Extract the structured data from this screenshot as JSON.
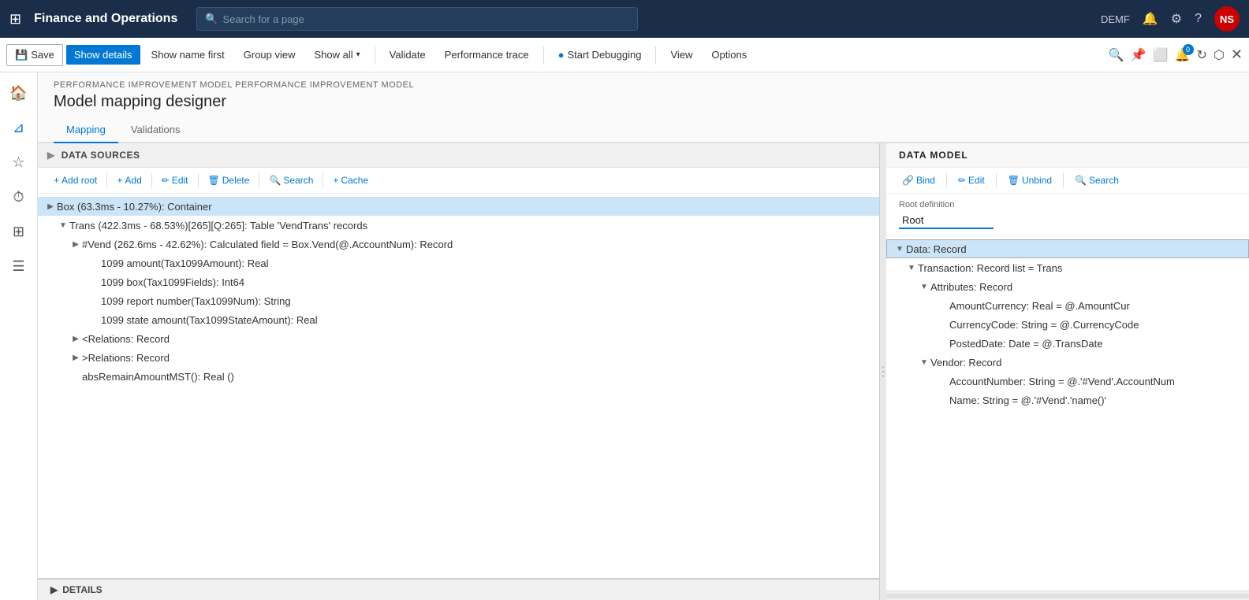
{
  "app": {
    "title": "Finance and Operations",
    "search_placeholder": "Search for a page",
    "user": "DEMF",
    "avatar_initials": "NS"
  },
  "toolbar": {
    "save_label": "Save",
    "show_details_label": "Show details",
    "show_name_first_label": "Show name first",
    "group_view_label": "Group view",
    "show_all_label": "Show all",
    "validate_label": "Validate",
    "performance_trace_label": "Performance trace",
    "start_debugging_label": "Start Debugging",
    "view_label": "View",
    "options_label": "Options"
  },
  "breadcrumb": "PERFORMANCE IMPROVEMENT MODEL PERFORMANCE IMPROVEMENT MODEL",
  "page_title": "Model mapping designer",
  "tabs": [
    {
      "label": "Mapping",
      "active": true
    },
    {
      "label": "Validations",
      "active": false
    }
  ],
  "data_sources": {
    "section_label": "DATA SOURCES",
    "toolbar_buttons": [
      {
        "label": "Add root",
        "icon": "+"
      },
      {
        "label": "Add",
        "icon": "+"
      },
      {
        "label": "Edit",
        "icon": "✏"
      },
      {
        "label": "Delete",
        "icon": "🗑"
      },
      {
        "label": "Search",
        "icon": "🔍"
      },
      {
        "label": "Cache",
        "icon": "+"
      }
    ],
    "tree": [
      {
        "id": 1,
        "indent": 0,
        "has_children": true,
        "expanded": true,
        "selected": true,
        "text": "Box (63.3ms - 10.27%): Container"
      },
      {
        "id": 2,
        "indent": 1,
        "has_children": true,
        "expanded": true,
        "selected": false,
        "text": "Trans (422.3ms - 68.53%)[265][Q:265]: Table 'VendTrans' records"
      },
      {
        "id": 3,
        "indent": 2,
        "has_children": true,
        "expanded": false,
        "selected": false,
        "text": "#Vend (262.6ms - 42.62%): Calculated field = Box.Vend(@.AccountNum): Record"
      },
      {
        "id": 4,
        "indent": 3,
        "has_children": false,
        "expanded": false,
        "selected": false,
        "text": "1099 amount(Tax1099Amount): Real"
      },
      {
        "id": 5,
        "indent": 3,
        "has_children": false,
        "expanded": false,
        "selected": false,
        "text": "1099 box(Tax1099Fields): Int64"
      },
      {
        "id": 6,
        "indent": 3,
        "has_children": false,
        "expanded": false,
        "selected": false,
        "text": "1099 report number(Tax1099Num): String"
      },
      {
        "id": 7,
        "indent": 3,
        "has_children": false,
        "expanded": false,
        "selected": false,
        "text": "1099 state amount(Tax1099StateAmount): Real"
      },
      {
        "id": 8,
        "indent": 2,
        "has_children": true,
        "expanded": false,
        "selected": false,
        "text": "<Relations: Record"
      },
      {
        "id": 9,
        "indent": 2,
        "has_children": true,
        "expanded": false,
        "selected": false,
        "text": ">Relations: Record"
      },
      {
        "id": 10,
        "indent": 2,
        "has_children": false,
        "expanded": false,
        "selected": false,
        "text": "absRemainAmountMST(): Real ()"
      }
    ]
  },
  "data_model": {
    "section_label": "DATA MODEL",
    "toolbar_buttons": [
      {
        "label": "Bind",
        "icon": "🔗"
      },
      {
        "label": "Edit",
        "icon": "✏"
      },
      {
        "label": "Unbind",
        "icon": "🗑"
      },
      {
        "label": "Search",
        "icon": "🔍"
      }
    ],
    "root_definition_label": "Root definition",
    "root_value": "Root",
    "tree": [
      {
        "id": 1,
        "indent": 0,
        "has_children": true,
        "expanded": true,
        "selected": true,
        "text": "Data: Record"
      },
      {
        "id": 2,
        "indent": 1,
        "has_children": true,
        "expanded": true,
        "selected": false,
        "text": "Transaction: Record list = Trans"
      },
      {
        "id": 3,
        "indent": 2,
        "has_children": true,
        "expanded": true,
        "selected": false,
        "text": "Attributes: Record"
      },
      {
        "id": 4,
        "indent": 3,
        "has_children": false,
        "expanded": false,
        "selected": false,
        "text": "AmountCurrency: Real = @.AmountCur"
      },
      {
        "id": 5,
        "indent": 3,
        "has_children": false,
        "expanded": false,
        "selected": false,
        "text": "CurrencyCode: String = @.CurrencyCode"
      },
      {
        "id": 6,
        "indent": 3,
        "has_children": false,
        "expanded": false,
        "selected": false,
        "text": "PostedDate: Date = @.TransDate"
      },
      {
        "id": 7,
        "indent": 2,
        "has_children": true,
        "expanded": true,
        "selected": false,
        "text": "Vendor: Record"
      },
      {
        "id": 8,
        "indent": 3,
        "has_children": false,
        "expanded": false,
        "selected": false,
        "text": "AccountNumber: String = @.'#Vend'.AccountNum"
      },
      {
        "id": 9,
        "indent": 3,
        "has_children": false,
        "expanded": false,
        "selected": false,
        "text": "Name: String = @.'#Vend'.'name()'"
      }
    ]
  },
  "details": {
    "label": "DETAILS"
  }
}
